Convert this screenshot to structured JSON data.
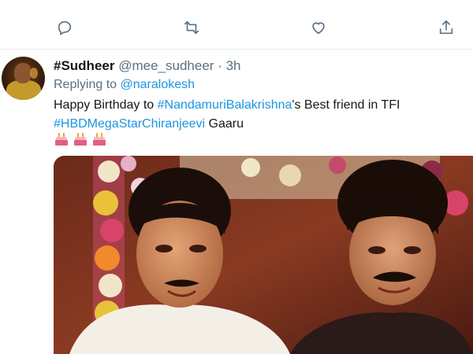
{
  "tweet": {
    "author_name": "#Sudheer",
    "handle": "@mee_sudheer",
    "separator": "·",
    "time": "3h",
    "replying_prefix": "Replying to",
    "replying_to": "@naralokesh",
    "text_before": "Happy Birthday to ",
    "hashtag_1": "#NandamuriBalakrishna",
    "text_middle": "'s Best friend in TFI",
    "hashtag_2": "#HBDMegaStarChiranjeevi",
    "text_after": " Gaaru",
    "emoji_count": 3
  },
  "actions": {
    "icons": [
      "reply-icon",
      "retweet-icon",
      "like-icon",
      "share-icon"
    ]
  },
  "colors": {
    "link": "#1b95e0",
    "secondary_text": "#5b7083",
    "divider": "#e6ecf0"
  }
}
